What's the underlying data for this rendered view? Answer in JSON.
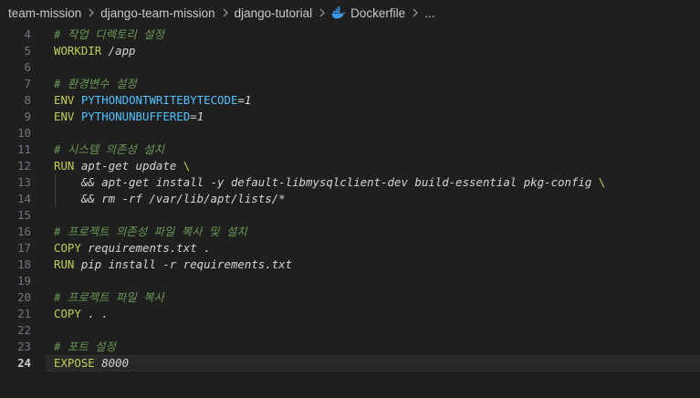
{
  "breadcrumb": {
    "items": [
      "team-mission",
      "django-team-mission",
      "django-tutorial",
      "Dockerfile"
    ],
    "more": "..."
  },
  "code": {
    "current_line": 24,
    "lines": [
      {
        "n": 4,
        "tokens": [
          {
            "t": "comment",
            "v": "# 작업 디렉토리 설정"
          }
        ]
      },
      {
        "n": 5,
        "tokens": [
          {
            "t": "keyword",
            "v": "WORKDIR"
          },
          {
            "t": "plain",
            "v": " /app"
          }
        ]
      },
      {
        "n": 6,
        "tokens": []
      },
      {
        "n": 7,
        "tokens": [
          {
            "t": "comment",
            "v": "# 환경변수 설정"
          }
        ]
      },
      {
        "n": 8,
        "tokens": [
          {
            "t": "keyword",
            "v": "ENV"
          },
          {
            "t": "op",
            "v": " "
          },
          {
            "t": "var",
            "v": "PYTHONDONTWRITEBYTECODE"
          },
          {
            "t": "op",
            "v": "="
          },
          {
            "t": "num",
            "v": "1"
          }
        ]
      },
      {
        "n": 9,
        "tokens": [
          {
            "t": "keyword",
            "v": "ENV"
          },
          {
            "t": "op",
            "v": " "
          },
          {
            "t": "var",
            "v": "PYTHONUNBUFFERED"
          },
          {
            "t": "op",
            "v": "="
          },
          {
            "t": "num",
            "v": "1"
          }
        ]
      },
      {
        "n": 10,
        "tokens": []
      },
      {
        "n": 11,
        "tokens": [
          {
            "t": "comment",
            "v": "# 시스템 의존성 설치"
          }
        ]
      },
      {
        "n": 12,
        "tokens": [
          {
            "t": "keyword",
            "v": "RUN"
          },
          {
            "t": "plain",
            "v": " apt-get update "
          },
          {
            "t": "keyword",
            "v": "\\"
          }
        ]
      },
      {
        "n": 13,
        "indent": true,
        "tokens": [
          {
            "t": "plain",
            "v": "    && apt-get install -y default-libmysqlclient-dev build-essential pkg-config "
          },
          {
            "t": "keyword",
            "v": "\\"
          }
        ]
      },
      {
        "n": 14,
        "indent": true,
        "tokens": [
          {
            "t": "plain",
            "v": "    && rm -rf /var/lib/apt/lists/*"
          }
        ]
      },
      {
        "n": 15,
        "tokens": []
      },
      {
        "n": 16,
        "tokens": [
          {
            "t": "comment",
            "v": "# 프로젝트 의존성 파일 복사 및 설치"
          }
        ]
      },
      {
        "n": 17,
        "tokens": [
          {
            "t": "keyword",
            "v": "COPY"
          },
          {
            "t": "plain",
            "v": " requirements.txt ."
          }
        ]
      },
      {
        "n": 18,
        "tokens": [
          {
            "t": "keyword",
            "v": "RUN"
          },
          {
            "t": "plain",
            "v": " pip install -r requirements.txt"
          }
        ]
      },
      {
        "n": 19,
        "tokens": []
      },
      {
        "n": 20,
        "tokens": [
          {
            "t": "comment",
            "v": "# 프로젝트 파일 복사"
          }
        ]
      },
      {
        "n": 21,
        "tokens": [
          {
            "t": "keyword",
            "v": "COPY"
          },
          {
            "t": "plain",
            "v": " . ."
          }
        ]
      },
      {
        "n": 22,
        "tokens": []
      },
      {
        "n": 23,
        "tokens": [
          {
            "t": "comment",
            "v": "# 포트 설정"
          }
        ]
      },
      {
        "n": 24,
        "tokens": [
          {
            "t": "keyword",
            "v": "EXPOSE"
          },
          {
            "t": "num",
            "v": " 8000"
          }
        ]
      }
    ]
  },
  "colors": {
    "background": "#1f1f1f",
    "comment": "#6a9955",
    "keyword": "#c3ce57",
    "variable": "#4fc1ff",
    "text": "#d4d4d4",
    "line_number": "#6e7681",
    "docker_icon": "#3b9ae8"
  }
}
